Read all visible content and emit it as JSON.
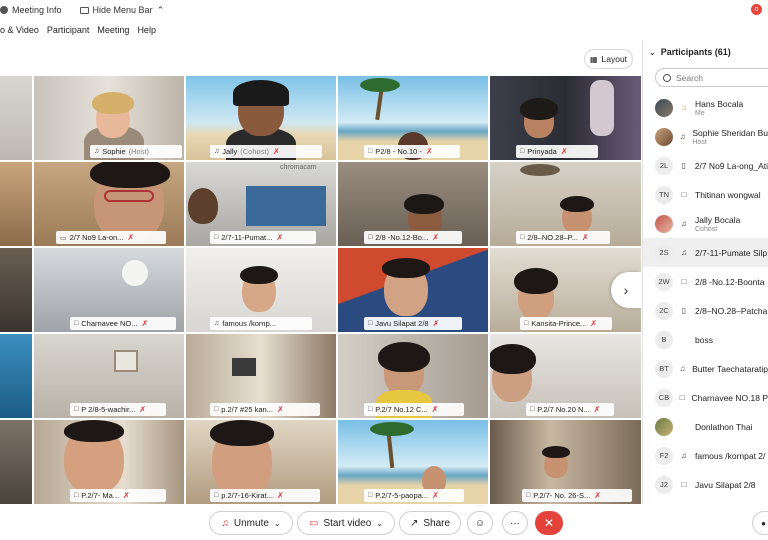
{
  "titlebar": {
    "meeting_info": "Meeting Info",
    "hide_menu_bar": "Hide Menu Bar",
    "close_glyph": "o"
  },
  "menubar": {
    "items": [
      "o & Video",
      "Participant",
      "Meeting",
      "Help"
    ]
  },
  "layout_button": "Layout",
  "tiles": [
    {
      "label": "Sophie",
      "sub": "(Host)"
    },
    {
      "label": "Jally",
      "sub": "(Cohost)"
    },
    {
      "label": "P2/8 - No.10 -",
      "sub": ""
    },
    {
      "label": "Prinyada",
      "sub": ""
    },
    {
      "label": "2/7 No9 La-on...",
      "sub": ""
    },
    {
      "label": "2/7-11-Pumat...",
      "sub": ""
    },
    {
      "label": "2/8 -No.12-Bo...",
      "sub": ""
    },
    {
      "label": "2/8–NO.28–P...",
      "sub": ""
    },
    {
      "label": "Charnavee NO...",
      "sub": ""
    },
    {
      "label": "famous /kornp...",
      "sub": ""
    },
    {
      "label": "Javu Silapat 2/8",
      "sub": ""
    },
    {
      "label": "Kansita-Prince...",
      "sub": ""
    },
    {
      "label": "P 2/8-5-wachir...",
      "sub": ""
    },
    {
      "label": "p.2/7 #25 kan...",
      "sub": ""
    },
    {
      "label": "P.2/7 No.12 C...",
      "sub": ""
    },
    {
      "label": "P.2/7 No.20 N...",
      "sub": ""
    },
    {
      "label": "P.2/7- Ma...",
      "sub": ""
    },
    {
      "label": "p.2/7-16-Kirat...",
      "sub": ""
    },
    {
      "label": "P.2/7-5-paopa...",
      "sub": ""
    },
    {
      "label": "P.2/7- No. 26-S...",
      "sub": ""
    }
  ],
  "chromacam": "chromacam",
  "next_arrow": "›",
  "participants_panel": {
    "title": "Participants (61)",
    "search_placeholder": "Search",
    "rows": [
      {
        "avatar": "",
        "name": "Hans Bocala",
        "role": "Me"
      },
      {
        "avatar": "",
        "name": "Sophie Sheridan Bu",
        "role": "Host"
      },
      {
        "avatar": "2L",
        "name": "2/7 No9 La-ong_Ati",
        "role": ""
      },
      {
        "avatar": "TN",
        "name": "Thitinan wongwal",
        "role": ""
      },
      {
        "avatar": "",
        "name": "Jally Bocala",
        "role": "Cohost"
      },
      {
        "avatar": "2S",
        "name": "2/7-11-Pumate Silp",
        "role": ""
      },
      {
        "avatar": "2W",
        "name": "2/8 -No.12-Boonta",
        "role": ""
      },
      {
        "avatar": "2C",
        "name": "2/8–NO.28–Patcha",
        "role": ""
      },
      {
        "avatar": "B",
        "name": "boss",
        "role": ""
      },
      {
        "avatar": "BT",
        "name": "Butter Taechataratip",
        "role": ""
      },
      {
        "avatar": "CB",
        "name": "Charnavee NO.18 P",
        "role": ""
      },
      {
        "avatar": "",
        "name": "Donlathon Thai",
        "role": ""
      },
      {
        "avatar": "F2",
        "name": "famous /kornpat 2/",
        "role": ""
      },
      {
        "avatar": "J2",
        "name": "Javu Silapat 2/8",
        "role": ""
      }
    ]
  },
  "toolbar": {
    "unmute": "Unmute",
    "start_video": "Start video",
    "share": "Share",
    "more": "···",
    "end": "✕"
  },
  "colors": {
    "accent_red": "#e3433a",
    "mute_red": "#d33333"
  }
}
